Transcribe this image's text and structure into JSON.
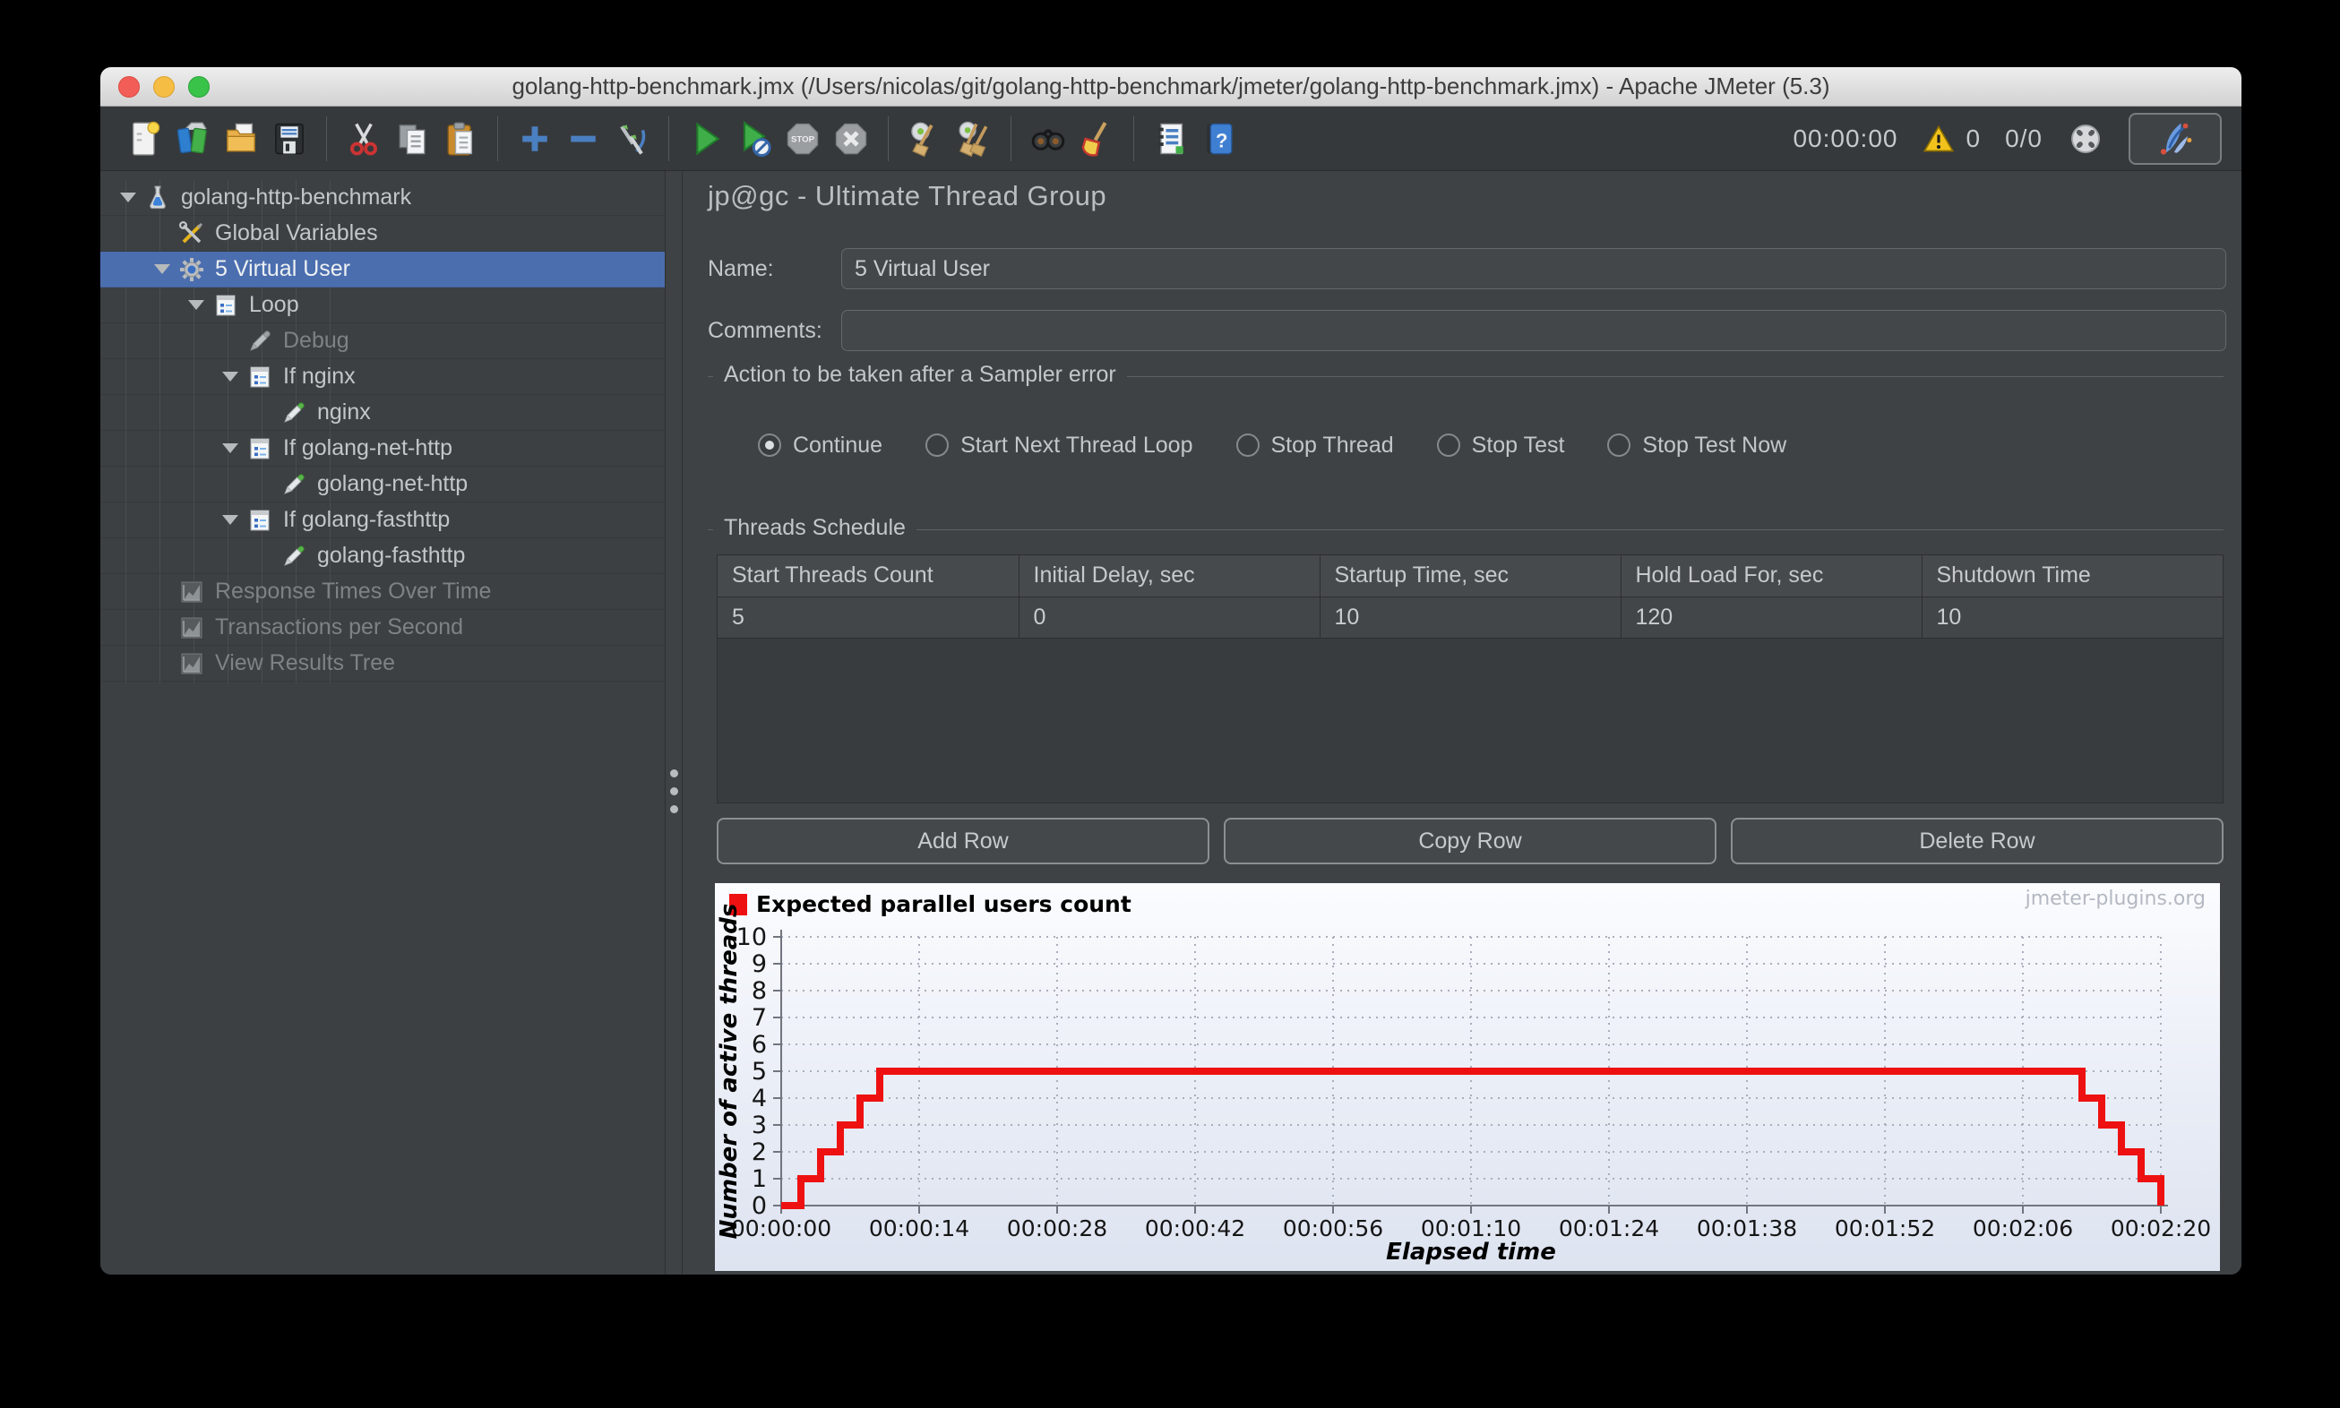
{
  "window": {
    "title": "golang-http-benchmark.jmx (/Users/nicolas/git/golang-http-benchmark/jmeter/golang-http-benchmark.jmx) - Apache JMeter (5.3)"
  },
  "toolbar": {
    "timer": "00:00:00",
    "warning_count": "0",
    "thread_status": "0/0",
    "items": [
      {
        "id": "new-file"
      },
      {
        "id": "templates"
      },
      {
        "id": "open-file"
      },
      {
        "id": "save"
      },
      {
        "sep": true
      },
      {
        "id": "cut"
      },
      {
        "id": "copy"
      },
      {
        "id": "paste"
      },
      {
        "sep": true
      },
      {
        "id": "expand-all"
      },
      {
        "id": "collapse-all"
      },
      {
        "id": "toggle"
      },
      {
        "sep": true
      },
      {
        "id": "start"
      },
      {
        "id": "start-no-pauses"
      },
      {
        "id": "stop",
        "disabled": true
      },
      {
        "id": "shutdown",
        "disabled": true
      },
      {
        "sep": true
      },
      {
        "id": "clear"
      },
      {
        "id": "clear-all"
      },
      {
        "sep": true
      },
      {
        "id": "search"
      },
      {
        "id": "search-reset"
      },
      {
        "sep": true
      },
      {
        "id": "function-helper"
      },
      {
        "id": "help"
      }
    ]
  },
  "tree": {
    "items": [
      {
        "label": "golang-http-benchmark",
        "icon": "test-plan-icon",
        "depth": 0,
        "expanded": true
      },
      {
        "label": "Global Variables",
        "icon": "arguments-icon",
        "depth": 1
      },
      {
        "label": "5 Virtual User",
        "icon": "thread-group-icon",
        "depth": 1,
        "expanded": true,
        "selected": true
      },
      {
        "label": "Loop",
        "icon": "controller-icon",
        "depth": 2,
        "expanded": true
      },
      {
        "label": "Debug",
        "icon": "sampler-disabled-icon",
        "depth": 3,
        "disabled": true
      },
      {
        "label": "If nginx",
        "icon": "controller-icon",
        "depth": 3,
        "expanded": true
      },
      {
        "label": "nginx",
        "icon": "sampler-icon",
        "depth": 4
      },
      {
        "label": "If golang-net-http",
        "icon": "controller-icon",
        "depth": 3,
        "expanded": true
      },
      {
        "label": "golang-net-http",
        "icon": "sampler-icon",
        "depth": 4
      },
      {
        "label": "If golang-fasthttp",
        "icon": "controller-icon",
        "depth": 3,
        "expanded": true
      },
      {
        "label": "golang-fasthttp",
        "icon": "sampler-icon",
        "depth": 4
      },
      {
        "label": "Response Times Over Time",
        "icon": "listener-icon",
        "depth": 1,
        "disabled": true
      },
      {
        "label": "Transactions per Second",
        "icon": "listener-icon",
        "depth": 1,
        "disabled": true
      },
      {
        "label": "View Results Tree",
        "icon": "listener-icon",
        "depth": 1,
        "disabled": true
      }
    ]
  },
  "main": {
    "header": "jp@gc - Ultimate Thread Group",
    "name_label": "Name:",
    "name_value": "5 Virtual User",
    "comments_label": "Comments:",
    "comments_value": "",
    "action_group": {
      "title": "Action to be taken after a Sampler error",
      "options": [
        "Continue",
        "Start Next Thread Loop",
        "Stop Thread",
        "Stop Test",
        "Stop Test Now"
      ],
      "selected": "Continue"
    },
    "schedule": {
      "title": "Threads Schedule",
      "columns": [
        "Start Threads Count",
        "Initial Delay, sec",
        "Startup Time, sec",
        "Hold Load For, sec",
        "Shutdown Time"
      ],
      "rows": [
        [
          "5",
          "0",
          "10",
          "120",
          "10"
        ]
      ]
    },
    "buttons": [
      "Add Row",
      "Copy Row",
      "Delete Row"
    ]
  },
  "chart_data": {
    "type": "line",
    "step": true,
    "legend": "Expected parallel users count",
    "series_color": "#ee1111",
    "points": {
      "t_sec": [
        0,
        2,
        4,
        6,
        8,
        10,
        130,
        132,
        134,
        136,
        138,
        140
      ],
      "threads": [
        0,
        1,
        2,
        3,
        4,
        5,
        5,
        4,
        3,
        2,
        1,
        0
      ]
    },
    "xlabel": "Elapsed time",
    "ylabel": "Number of active threads",
    "ylim": [
      0,
      10
    ],
    "y_tick_step": 1,
    "x_ticks": [
      "00:00:00",
      "00:00:14",
      "00:00:28",
      "00:00:42",
      "00:00:56",
      "00:01:10",
      "00:01:24",
      "00:01:38",
      "00:01:52",
      "00:02:06",
      "00:02:20"
    ],
    "x_tick_seconds": [
      0,
      14,
      28,
      42,
      56,
      70,
      84,
      98,
      112,
      126,
      140
    ],
    "x_max_sec": 140,
    "grid": "dashed",
    "watermark": "jmeter-plugins.org"
  }
}
